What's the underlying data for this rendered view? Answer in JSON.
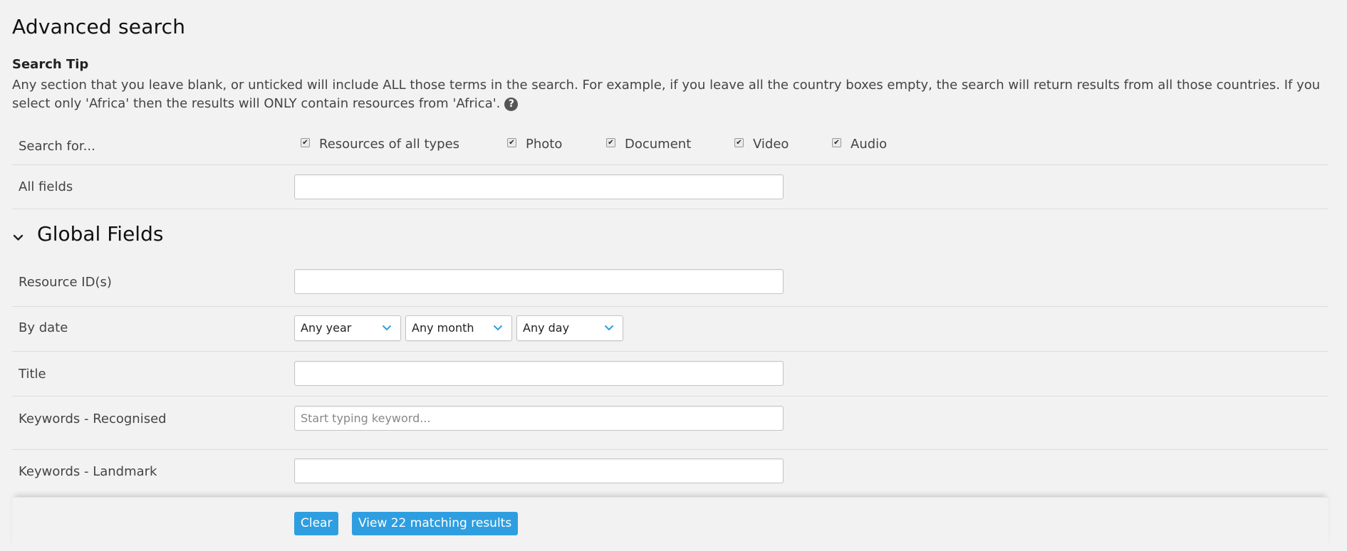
{
  "page": {
    "title": "Advanced search"
  },
  "tip": {
    "title": "Search Tip",
    "text": "Any section that you leave blank, or unticked will include ALL those terms in the search. For example, if you leave all the country boxes empty, the search will return results from all those countries. If you select only 'Africa' then the results will ONLY contain resources from 'Africa'.",
    "help_glyph": "?"
  },
  "search_for": {
    "label": "Search for...",
    "options": [
      {
        "label": "Resources of all types",
        "checked": true
      },
      {
        "label": "Photo",
        "checked": true
      },
      {
        "label": "Document",
        "checked": true
      },
      {
        "label": "Video",
        "checked": true
      },
      {
        "label": "Audio",
        "checked": true
      }
    ],
    "check_glyph": "✔"
  },
  "all_fields": {
    "label": "All fields",
    "value": ""
  },
  "global_fields": {
    "title": "Global Fields",
    "resource_ids": {
      "label": "Resource ID(s)",
      "value": ""
    },
    "by_date": {
      "label": "By date",
      "year": "Any year",
      "month": "Any month",
      "day": "Any day"
    },
    "title_field": {
      "label": "Title",
      "value": ""
    },
    "keywords_recognised": {
      "label": "Keywords - Recognised",
      "placeholder": "Start typing keyword..."
    },
    "keywords_landmark": {
      "label": "Keywords - Landmark",
      "value": ""
    }
  },
  "footer": {
    "clear_label": "Clear",
    "view_label": "View 22 matching results"
  },
  "colors": {
    "accent": "#2f9ee0",
    "background": "#f2f2f2"
  }
}
